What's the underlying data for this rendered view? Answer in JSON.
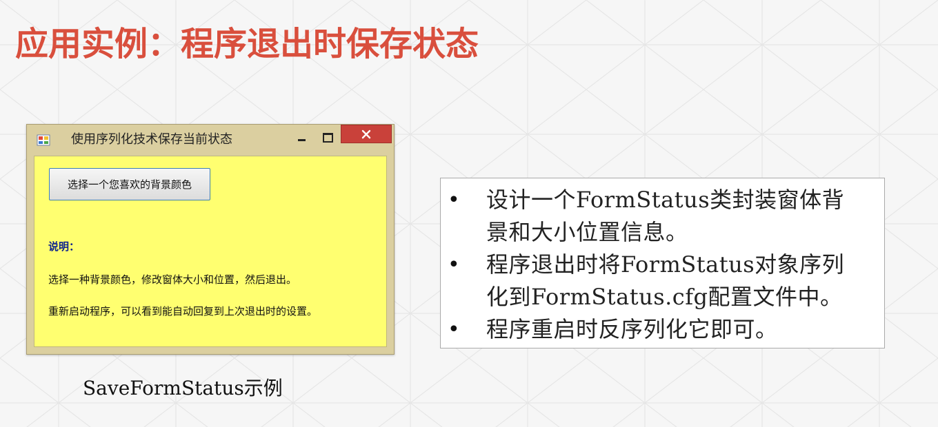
{
  "slide": {
    "title": "应用实例：程序退出时保存状态",
    "caption": "SaveFormStatus示例"
  },
  "window": {
    "title": "使用序列化技术保存当前状态",
    "close_glyph": "✕",
    "color_button_label": "选择一个您喜欢的背景颜色",
    "note_label": "说明：",
    "note_lines": [
      "选择一种背景颜色，修改窗体大小和位置，然后退出。",
      "重新启动程序，可以看到能自动回复到上次退出时的设置。"
    ],
    "client_color": "#ffff70"
  },
  "bullets": {
    "marker": "•",
    "items": [
      {
        "line1": "设计一个FormStatus类封装窗体背",
        "line2": "景和大小位置信息。"
      },
      {
        "line1": "程序退出时将FormStatus对象序列",
        "line2": "化到FormStatus.cfg配置文件中。"
      },
      {
        "line1": "程序重启时反序列化它即可。",
        "line2": ""
      }
    ]
  },
  "colors": {
    "title_red": "#d94f3d",
    "close_button": "#c9413a",
    "note_label_blue": "#0a1f8f"
  }
}
